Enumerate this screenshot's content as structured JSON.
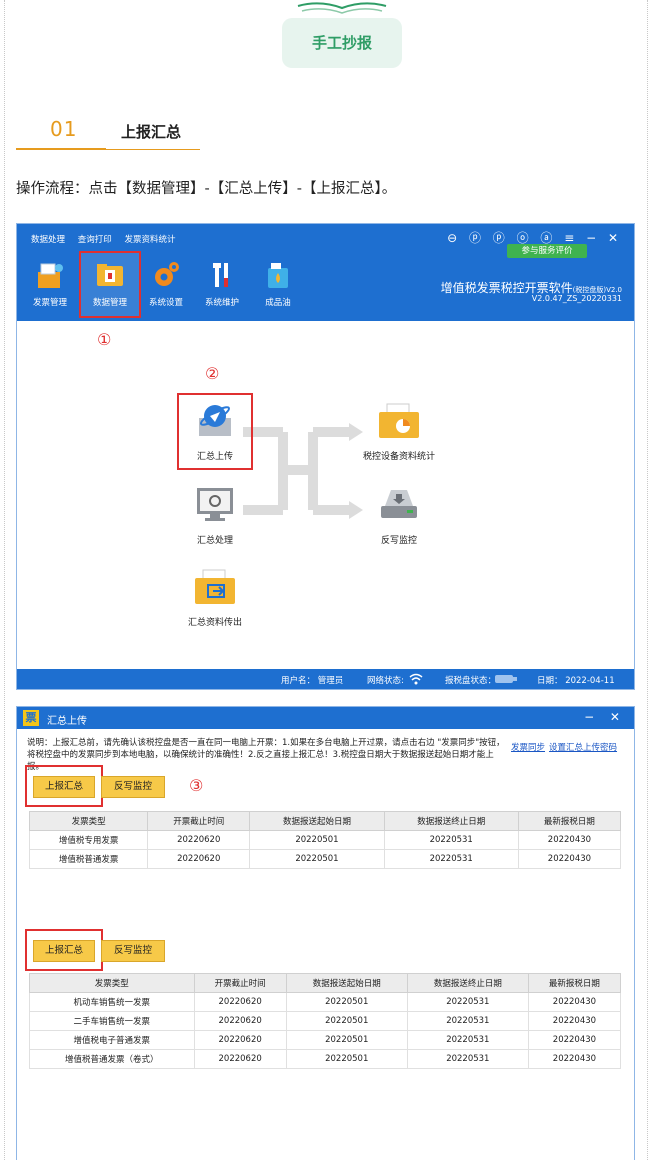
{
  "header": {
    "badge": "手工抄报"
  },
  "section": {
    "num": "01",
    "title": "上报汇总"
  },
  "flow_text": "操作流程：点击【数据管理】-【汇总上传】-【上报汇总】。",
  "shot1": {
    "menu": [
      "数据处理",
      "查询打印",
      "发票资料统计"
    ],
    "window_icons": "⊖ ⓟ ⓟ ⓞ ⓐ ≡ − ✕",
    "rate_btn": "参与服务评价",
    "app_title": "增值税发票税控开票软件",
    "app_title_small": "(税控盘版)V2.0",
    "version": "V2.0.47_ZS_20220331",
    "toolbar": [
      "发票管理",
      "数据管理",
      "系统设置",
      "系统维护",
      "成品油"
    ],
    "marks": [
      "①",
      "②"
    ],
    "functions": [
      "汇总上传",
      "汇总处理",
      "汇总资料传出",
      "税控设备资料统计",
      "反写监控"
    ],
    "status": {
      "user": "用户名： 管理员",
      "net": "网络状态:",
      "disk": "报税盘状态：",
      "date": "日期： 2022-04-11"
    }
  },
  "shot2": {
    "title": "汇总上传",
    "logo": "票",
    "controls": "− ✕",
    "note": "说明：上报汇总前，请先确认该税控盘是否一直在同一电脑上开票：1.如果在多台电脑上开过票，请点击右边 \"发票同步\"按钮，将税控盘中的发票同步到本地电脑，以确保统计的准确性！2.反之直接上报汇总！3.税控盘日期大于数据报送起始日期才能上报。",
    "links": [
      "发票同步",
      "设置汇总上传密码"
    ],
    "btn_report": "上报汇总",
    "btn_monitor": "反写监控",
    "mark3": "③",
    "columns": [
      "发票类型",
      "开票截止时间",
      "数据报送起始日期",
      "数据报送终止日期",
      "最新报税日期"
    ],
    "table1": [
      [
        "增值税专用发票",
        "20220620",
        "20220501",
        "20220531",
        "20220430"
      ],
      [
        "增值税普通发票",
        "20220620",
        "20220501",
        "20220531",
        "20220430"
      ]
    ],
    "table2": [
      [
        "机动车销售统一发票",
        "20220620",
        "20220501",
        "20220531",
        "20220430"
      ],
      [
        "二手车销售统一发票",
        "20220620",
        "20220501",
        "20220531",
        "20220430"
      ],
      [
        "增值税电子普通发票",
        "20220620",
        "20220501",
        "20220531",
        "20220430"
      ],
      [
        "增值税普通发票（卷式）",
        "20220620",
        "20220501",
        "20220531",
        "20220430"
      ]
    ]
  }
}
